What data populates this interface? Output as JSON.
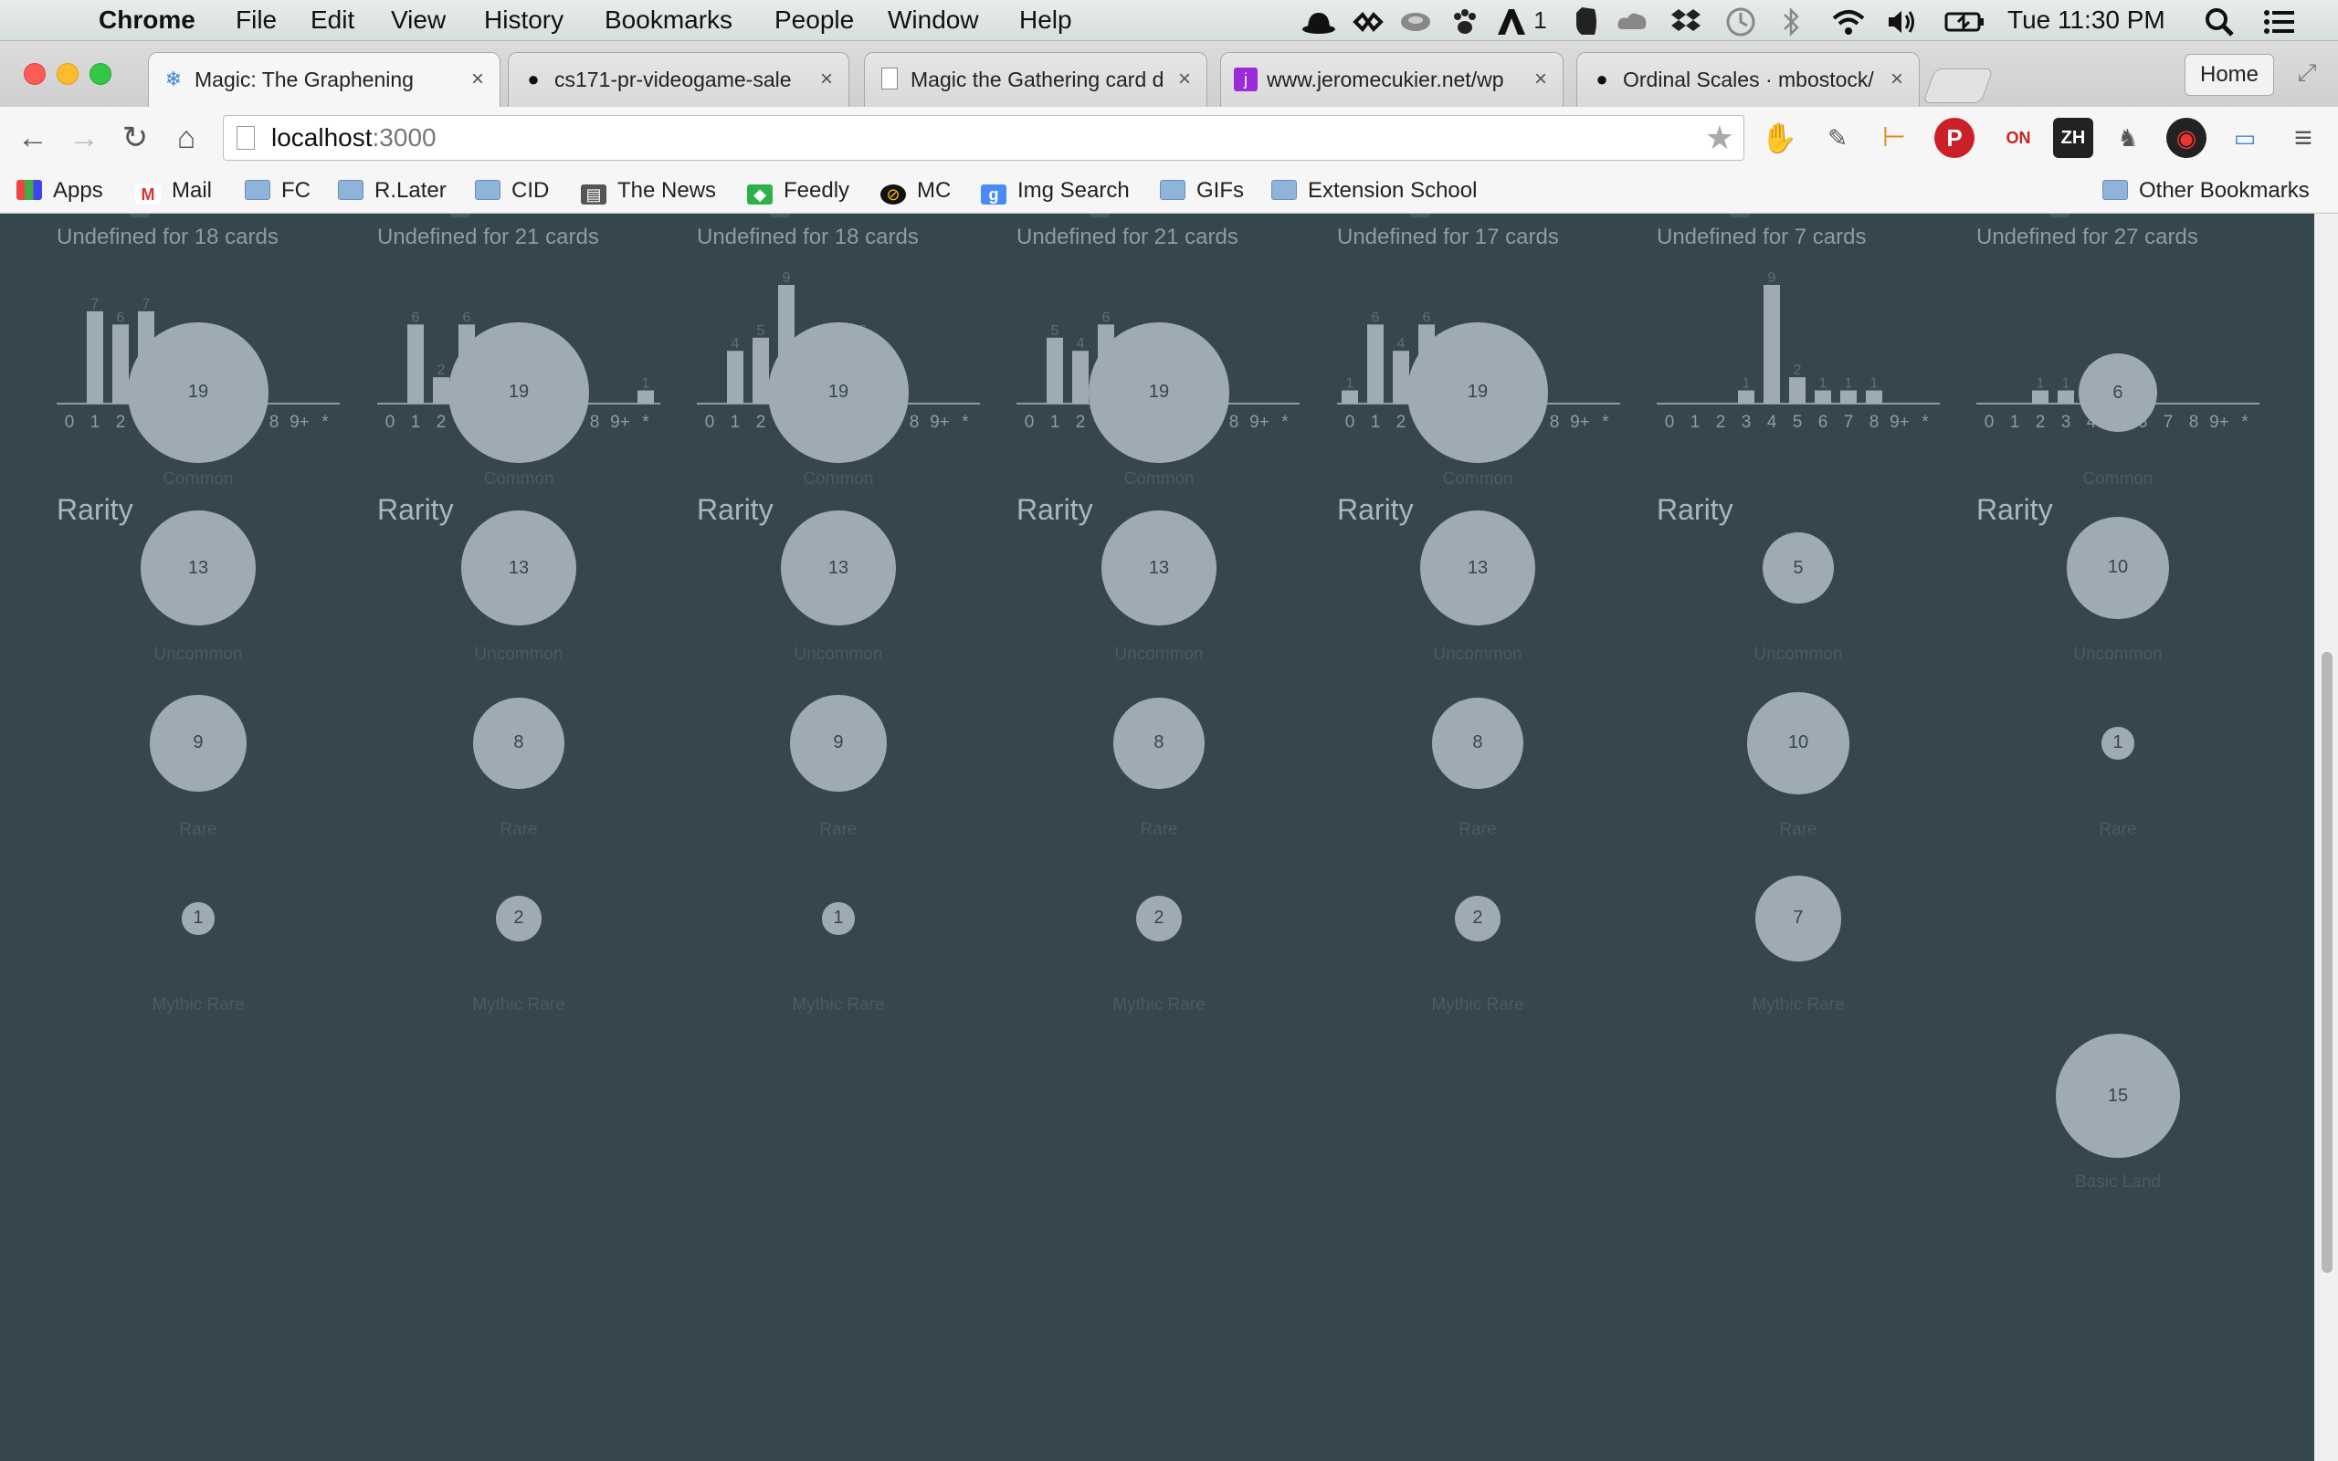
{
  "menubar": {
    "app": "Chrome",
    "items": [
      "File",
      "Edit",
      "View",
      "History",
      "Bookmarks",
      "People",
      "Window",
      "Help"
    ],
    "tray_icons": [
      "hat-icon",
      "infinity-icon",
      "disk-icon",
      "paw-icon",
      "adobe-icon",
      "evernote-icon",
      "creative-cloud-icon",
      "dropbox-icon",
      "time-machine-icon",
      "bluetooth-icon",
      "wifi-icon",
      "volume-icon",
      "battery-icon"
    ],
    "adobe_count": "1",
    "clock": "Tue 11:30 PM"
  },
  "tabs": [
    {
      "title": "Magic: The Graphening",
      "icon": "snowflake-icon",
      "active": true
    },
    {
      "title": "cs171-pr-videogame-sale",
      "icon": "github-icon",
      "active": false
    },
    {
      "title": "Magic the Gathering card d",
      "icon": "page-icon",
      "active": false
    },
    {
      "title": "www.jeromecukier.net/wp",
      "icon": "j-icon",
      "active": false
    },
    {
      "title": "Ordinal Scales · mbostock/",
      "icon": "github-icon",
      "active": false
    }
  ],
  "home_button": "Home",
  "omnibox": {
    "host": "localhost",
    "port": ":3000"
  },
  "bookmarks": [
    {
      "label": "Apps",
      "icon": "apps-icon"
    },
    {
      "label": "Mail",
      "icon": "gmail-icon"
    },
    {
      "label": "FC",
      "icon": "folder-icon"
    },
    {
      "label": "R.Later",
      "icon": "folder-icon"
    },
    {
      "label": "CID",
      "icon": "folder-icon"
    },
    {
      "label": "The News",
      "icon": "news-icon"
    },
    {
      "label": "Feedly",
      "icon": "feedly-icon"
    },
    {
      "label": "MC",
      "icon": "mc-icon"
    },
    {
      "label": "Img Search",
      "icon": "google-icon"
    },
    {
      "label": "GIFs",
      "icon": "folder-icon"
    },
    {
      "label": "Extension School",
      "icon": "folder-icon"
    }
  ],
  "other_bookmarks": "Other Bookmarks",
  "colors": {
    "background": "#36464f",
    "bar": "#9fabb2",
    "label": "#4a5a63",
    "heading": "#aab6bd",
    "axis": "#8d9ba4"
  },
  "mana_axis_labels": [
    "0",
    "1",
    "2",
    "3",
    "4",
    "5",
    "6",
    "7",
    "8",
    "9+",
    "*"
  ],
  "rarity_heading": "Rarity",
  "columns": [
    {
      "undefined_text": "Undefined for 18 cards",
      "mana_curve": [
        {
          "label": "",
          "v": 0
        },
        {
          "label": "7",
          "v": 7
        },
        {
          "label": "6",
          "v": 6
        },
        {
          "label": "7",
          "v": 7
        },
        {
          "label": "4",
          "v": 4
        },
        {
          "label": "",
          "v": 0
        },
        {
          "label": "",
          "v": 0
        },
        {
          "label": "",
          "v": 0
        },
        {
          "label": "",
          "v": 0
        },
        {
          "label": "",
          "v": 0
        },
        {
          "label": "",
          "v": 0
        }
      ],
      "rarity": [
        {
          "label": "Common",
          "value": 19
        },
        {
          "label": "Uncommon",
          "value": 13
        },
        {
          "label": "Rare",
          "value": 9
        },
        {
          "label": "Mythic Rare",
          "value": 1
        }
      ]
    },
    {
      "undefined_text": "Undefined for 21 cards",
      "mana_curve": [
        {
          "label": "",
          "v": 0
        },
        {
          "label": "6",
          "v": 6
        },
        {
          "label": "2",
          "v": 2
        },
        {
          "label": "6",
          "v": 6
        },
        {
          "label": "4",
          "v": 4
        },
        {
          "label": "2",
          "v": 2
        },
        {
          "label": "",
          "v": 0
        },
        {
          "label": "",
          "v": 0
        },
        {
          "label": "",
          "v": 0
        },
        {
          "label": "",
          "v": 0
        },
        {
          "label": "1",
          "v": 1
        }
      ],
      "rarity": [
        {
          "label": "Common",
          "value": 19
        },
        {
          "label": "Uncommon",
          "value": 13
        },
        {
          "label": "Rare",
          "value": 8
        },
        {
          "label": "Mythic Rare",
          "value": 2
        }
      ]
    },
    {
      "undefined_text": "Undefined for 18 cards",
      "mana_curve": [
        {
          "label": "",
          "v": 0
        },
        {
          "label": "4",
          "v": 4
        },
        {
          "label": "5",
          "v": 5
        },
        {
          "label": "9",
          "v": 9
        },
        {
          "label": "",
          "v": 0
        },
        {
          "label": "1",
          "v": 1
        },
        {
          "label": "5",
          "v": 5
        },
        {
          "label": "",
          "v": 0
        },
        {
          "label": "",
          "v": 0
        },
        {
          "label": "",
          "v": 0
        },
        {
          "label": "",
          "v": 0
        }
      ],
      "rarity": [
        {
          "label": "Common",
          "value": 19
        },
        {
          "label": "Uncommon",
          "value": 13
        },
        {
          "label": "Rare",
          "value": 9
        },
        {
          "label": "Mythic Rare",
          "value": 1
        }
      ]
    },
    {
      "undefined_text": "Undefined for 21 cards",
      "mana_curve": [
        {
          "label": "",
          "v": 0
        },
        {
          "label": "5",
          "v": 5
        },
        {
          "label": "4",
          "v": 4
        },
        {
          "label": "6",
          "v": 6
        },
        {
          "label": "2",
          "v": 2
        },
        {
          "label": "3",
          "v": 3
        },
        {
          "label": "1",
          "v": 1
        },
        {
          "label": "",
          "v": 0
        },
        {
          "label": "",
          "v": 0
        },
        {
          "label": "",
          "v": 0
        },
        {
          "label": "",
          "v": 0
        }
      ],
      "rarity": [
        {
          "label": "Common",
          "value": 19
        },
        {
          "label": "Uncommon",
          "value": 13
        },
        {
          "label": "Rare",
          "value": 8
        },
        {
          "label": "Mythic Rare",
          "value": 2
        }
      ]
    },
    {
      "undefined_text": "Undefined for 17 cards",
      "mana_curve": [
        {
          "label": "1",
          "v": 1
        },
        {
          "label": "6",
          "v": 6
        },
        {
          "label": "4",
          "v": 4
        },
        {
          "label": "6",
          "v": 6
        },
        {
          "label": "4",
          "v": 4
        },
        {
          "label": "4",
          "v": 4
        },
        {
          "label": "",
          "v": 0
        },
        {
          "label": "",
          "v": 0
        },
        {
          "label": "",
          "v": 0
        },
        {
          "label": "",
          "v": 0
        },
        {
          "label": "",
          "v": 0
        }
      ],
      "rarity": [
        {
          "label": "Common",
          "value": 19
        },
        {
          "label": "Uncommon",
          "value": 13
        },
        {
          "label": "Rare",
          "value": 8
        },
        {
          "label": "Mythic Rare",
          "value": 2
        }
      ]
    },
    {
      "undefined_text": "Undefined for 7 cards",
      "mana_curve": [
        {
          "label": "",
          "v": 0
        },
        {
          "label": "",
          "v": 0
        },
        {
          "label": "",
          "v": 0
        },
        {
          "label": "1",
          "v": 1
        },
        {
          "label": "9",
          "v": 9
        },
        {
          "label": "2",
          "v": 2
        },
        {
          "label": "1",
          "v": 1
        },
        {
          "label": "1",
          "v": 1
        },
        {
          "label": "1",
          "v": 1
        },
        {
          "label": "",
          "v": 0
        },
        {
          "label": "",
          "v": 0
        }
      ],
      "rarity": [
        {
          "label": "Common",
          "value": null
        },
        {
          "label": "Uncommon",
          "value": 5
        },
        {
          "label": "Rare",
          "value": 10
        },
        {
          "label": "Mythic Rare",
          "value": 7
        }
      ]
    },
    {
      "undefined_text": "Undefined for 27 cards",
      "mana_curve": [
        {
          "label": "",
          "v": 0
        },
        {
          "label": "",
          "v": 0
        },
        {
          "label": "1",
          "v": 1
        },
        {
          "label": "1",
          "v": 1
        },
        {
          "label": "2",
          "v": 2
        },
        {
          "label": "1",
          "v": 1
        },
        {
          "label": "",
          "v": 0
        },
        {
          "label": "",
          "v": 0
        },
        {
          "label": "",
          "v": 0
        },
        {
          "label": "",
          "v": 0
        },
        {
          "label": "",
          "v": 0
        }
      ],
      "rarity": [
        {
          "label": "Common",
          "value": 6
        },
        {
          "label": "Uncommon",
          "value": 10
        },
        {
          "label": "Rare",
          "value": 1
        },
        {
          "label": "Mythic Rare",
          "value": null
        },
        {
          "label": "Basic Land",
          "value": 15
        }
      ]
    }
  ]
}
